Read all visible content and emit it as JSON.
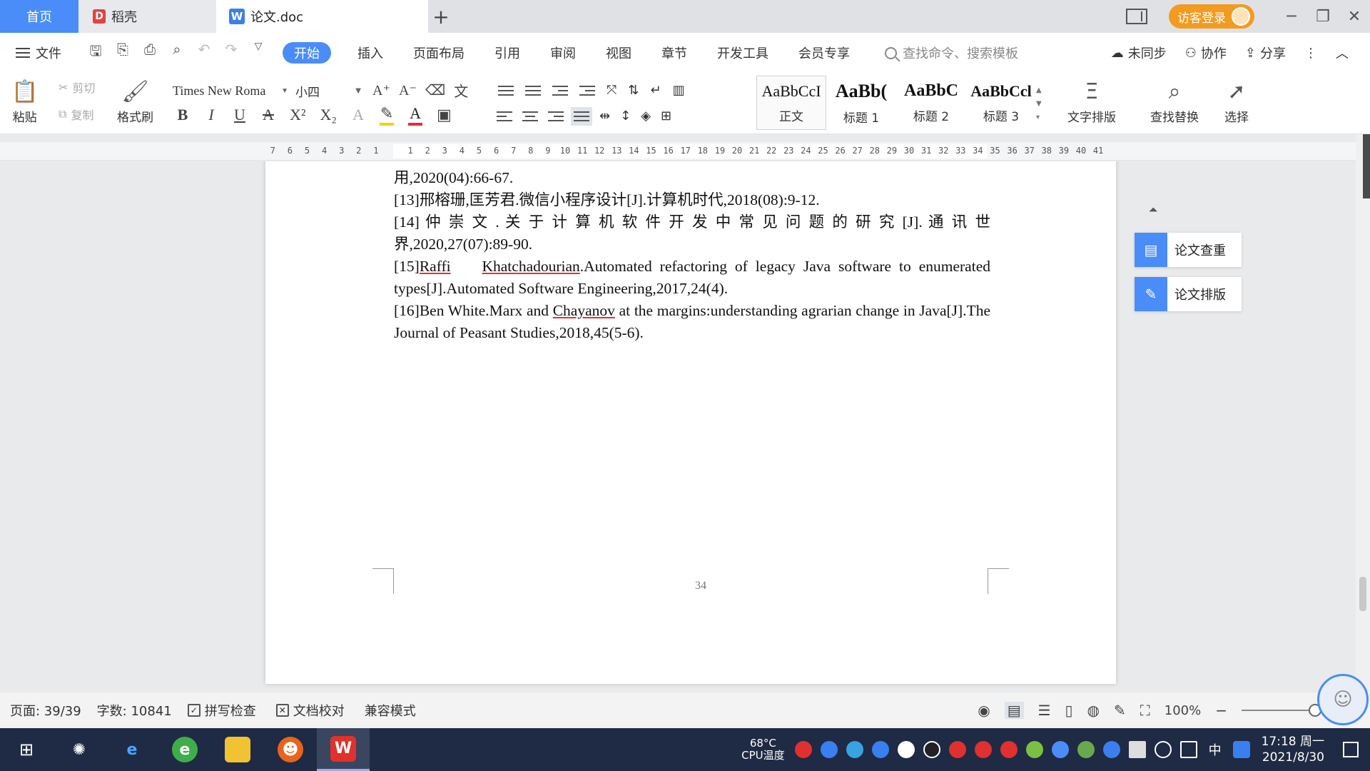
{
  "tabs": {
    "home": "首页",
    "docer": "稻壳",
    "doc": "论文.doc",
    "new_tab": "+"
  },
  "window": {
    "login": "访客登录",
    "minimize": "─",
    "restore": "❐",
    "close": "✕"
  },
  "menubar": {
    "file": "文件",
    "tabs": [
      "开始",
      "插入",
      "页面布局",
      "引用",
      "审阅",
      "视图",
      "章节",
      "开发工具",
      "会员专享"
    ],
    "search_placeholder": "查找命令、搜索模板",
    "sync": "未同步",
    "collab": "协作",
    "share": "分享"
  },
  "ribbon": {
    "paste": "粘贴",
    "cut": "剪切",
    "copy": "复制",
    "format_painter": "格式刷",
    "font_name": "Times New Roma",
    "font_size": "小四",
    "styles": [
      {
        "preview": "AaBbCcI",
        "name": "正文"
      },
      {
        "preview": "AaBb(",
        "name": "标题 1"
      },
      {
        "preview": "AaBbC",
        "name": "标题 2"
      },
      {
        "preview": "AaBbCcl",
        "name": "标题 3"
      }
    ],
    "text_layout": "文字排版",
    "find_replace": "查找替换",
    "select": "选择"
  },
  "ruler": {
    "left_ticks": [
      "7",
      "6",
      "5",
      "4",
      "3",
      "2",
      "1"
    ],
    "right_ticks": [
      "1",
      "2",
      "3",
      "4",
      "5",
      "6",
      "7",
      "8",
      "9",
      "10",
      "11",
      "12",
      "13",
      "14",
      "15",
      "16",
      "17",
      "18",
      "19",
      "20",
      "21",
      "22",
      "23",
      "24",
      "25",
      "26",
      "27",
      "28",
      "29",
      "30",
      "31",
      "32",
      "33",
      "34",
      "35",
      "36",
      "37",
      "38",
      "39",
      "40",
      "41"
    ]
  },
  "document": {
    "line0": "用,2020(04):66-67.",
    "ref13": "[13]邢榕珊,匡芳君.微信小程序设计[J].计算机时代,2018(08):9-12.",
    "ref14a": "[14] 仲 崇 文 . 关 于 计 算 机 软 件 开 发 中 常 见 问 题 的 研 究 [J]. 通 讯 世",
    "ref14b": "界,2020,27(07):89-90.",
    "ref15_pre": "[15]",
    "ref15_name1": "Raffi",
    "ref15_name2": "Khatchadourian",
    "ref15_rest": ".Automated refactoring of legacy Java software to enumerated types[J].Automated Software Engineering,2017,24(4).",
    "ref16_pre": "[16]Ben White.Marx and ",
    "ref16_name": "Chayanov",
    "ref16_rest": " at the margins:understanding agrarian change in Java[J].The Journal of Peasant Studies,2018,45(5-6).",
    "page_number": "34"
  },
  "side_panel": {
    "check": "论文查重",
    "layout": "论文排版"
  },
  "statusbar": {
    "page": "页面: 39/39",
    "words": "字数: 10841",
    "spell": "拼写检查",
    "proof": "文档校对",
    "compat": "兼容模式",
    "zoom": "100%"
  },
  "taskbar": {
    "cpu_temp": "68°C",
    "cpu_label": "CPU温度",
    "ime": "中",
    "time": "17:18 周一",
    "date": "2021/8/30"
  },
  "colors": {
    "accent": "#4a8df8",
    "login": "#f39b1f",
    "taskbar": "#1f2a44"
  }
}
